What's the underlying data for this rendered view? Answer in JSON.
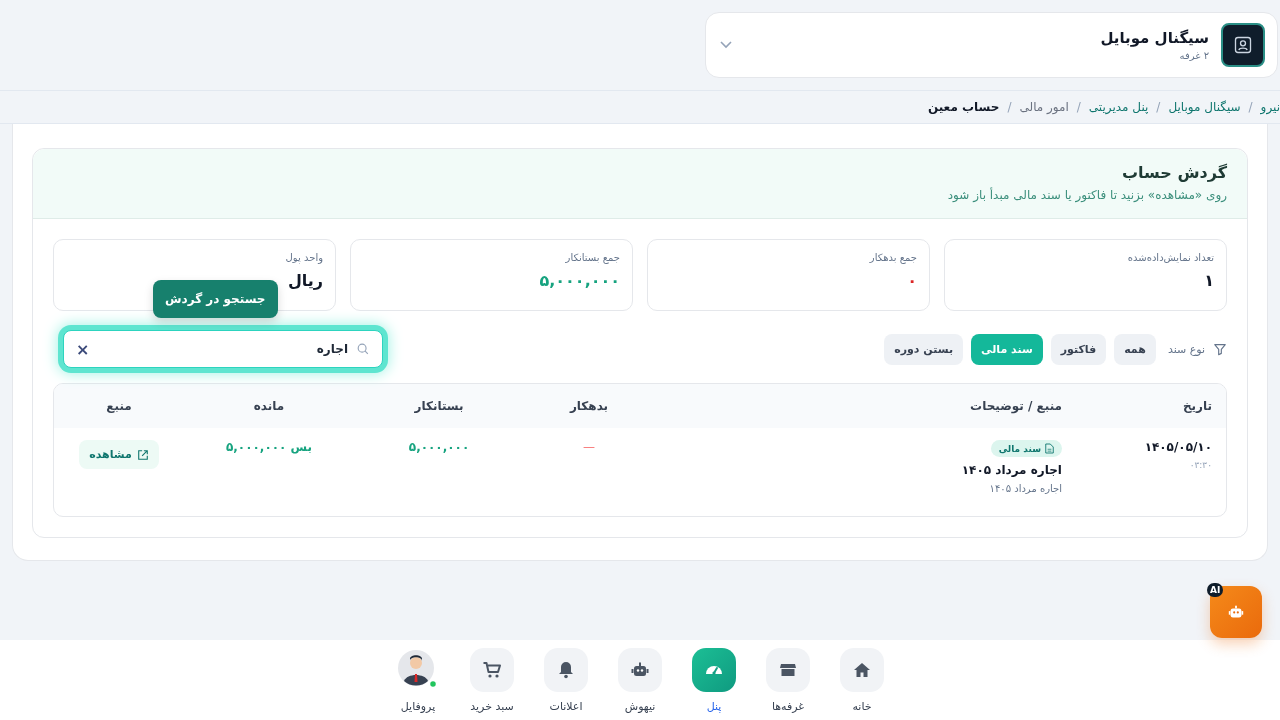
{
  "store": {
    "name": "سیگنال موبایل",
    "subtitle": "۲ غرفه"
  },
  "breadcrumb_separator": "/",
  "breadcrumb": [
    {
      "label": "نیرو",
      "kind": "link"
    },
    {
      "label": "سیگنال موبایل",
      "kind": "link"
    },
    {
      "label": "پنل مدیریتی",
      "kind": "link"
    },
    {
      "label": "امور مالی",
      "kind": "muted"
    },
    {
      "label": "حساب معین",
      "kind": "current"
    }
  ],
  "panel": {
    "title": "گردش حساب",
    "hint": "روی «مشاهده» بزنید تا فاکتور یا سند مالی مبدأ باز شود"
  },
  "stats": [
    {
      "label": "تعداد نمایش‌داده‌شده",
      "value": "۱",
      "color": "#111827"
    },
    {
      "label": "جمع بدهکار",
      "value": "۰",
      "color": "#dc2626"
    },
    {
      "label": "جمع بستانکار",
      "value": "۵,۰۰۰,۰۰۰",
      "color": "#16a37f"
    },
    {
      "label": "واحد پول",
      "value": "ریال",
      "color": "#111827"
    }
  ],
  "filter": {
    "label": "نوع سند",
    "chips": [
      {
        "label": "همه",
        "selected": false
      },
      {
        "label": "فاکتور",
        "selected": false
      },
      {
        "label": "سند مالی",
        "selected": true
      },
      {
        "label": "بستن دوره",
        "selected": false
      }
    ]
  },
  "search": {
    "value": "اجاره",
    "clear": "×",
    "tooltip": "جستجو در گردش"
  },
  "table": {
    "columns": [
      "تاریخ",
      "منبع / توضیحات",
      "بدهکار",
      "بستانکار",
      "مانده",
      "منبع"
    ],
    "rows": [
      {
        "date": "۱۴۰۵/۰۵/۱۰",
        "time": "۰۳:۳۰",
        "tag": "سند مالی",
        "title": "اجاره مرداد ۱۴۰۵",
        "note": "اجاره مرداد ۱۴۰۵",
        "debit": "—",
        "credit": "۵,۰۰۰,۰۰۰",
        "balance": "بس ۵,۰۰۰,۰۰۰",
        "action": "مشاهده"
      }
    ]
  },
  "ai_badge": "AI",
  "nav": [
    {
      "label": "خانه",
      "kind": "home",
      "selected": false
    },
    {
      "label": "غرفه‌ها",
      "kind": "store",
      "selected": false
    },
    {
      "label": "پنل",
      "kind": "gauge",
      "selected": true
    },
    {
      "label": "نیهوش",
      "kind": "robot",
      "selected": false
    },
    {
      "label": "اعلانات",
      "kind": "bell",
      "selected": false
    },
    {
      "label": "سبد خرید",
      "kind": "cart",
      "selected": false
    },
    {
      "label": "پروفایل",
      "kind": "profile",
      "selected": false
    }
  ]
}
